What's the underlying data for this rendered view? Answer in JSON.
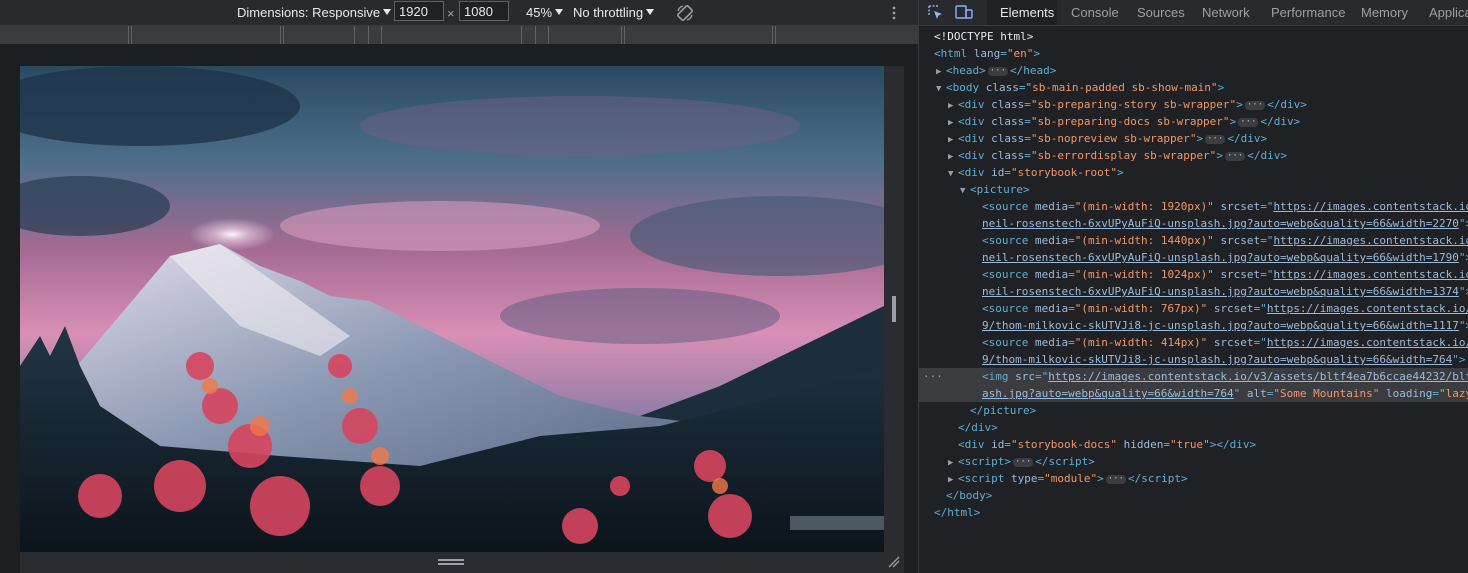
{
  "device_toolbar": {
    "dimensions_label": "Dimensions: Responsive",
    "width_value": "1920",
    "times": "×",
    "height_value": "1080",
    "zoom": "45%",
    "throttling": "No throttling",
    "rotate_icon": "rotate-icon",
    "more_icon": "more-vertical-icon"
  },
  "viewport": {
    "image_alt": "Some Mountains"
  },
  "devtools_tabs": [
    "Elements",
    "Console",
    "Sources",
    "Network",
    "Performance",
    "Memory",
    "Applica"
  ],
  "elements_tree": {
    "doctype": "<!DOCTYPE html>",
    "html_open": "html",
    "html_lang_attr": "lang",
    "html_lang_val": "\"en\"",
    "head": "head",
    "body_tag": "body",
    "body_class_val": "\"sb-main-padded sb-show-main\"",
    "div1_class": "\"sb-preparing-story sb-wrapper\"",
    "div2_class": "\"sb-preparing-docs sb-wrapper\"",
    "div3_class": "\"sb-nopreview sb-wrapper\"",
    "div4_class": "\"sb-errordisplay sb-wrapper\"",
    "root_id": "\"storybook-root\"",
    "picture": "picture",
    "sources": [
      {
        "media": "\"(min-width: 1920px)\"",
        "url1": "https://images.contentstack.io",
        "url2": "neil-rosenstech-6xvUPyAuFiQ-unsplash.jpg?auto=webp&quality=66&width=2270"
      },
      {
        "media": "\"(min-width: 1440px)\"",
        "url1": "https://images.contentstack.io",
        "url2": "neil-rosenstech-6xvUPyAuFiQ-unsplash.jpg?auto=webp&quality=66&width=1790"
      },
      {
        "media": "\"(min-width: 1024px)\"",
        "url1": "https://images.contentstack.io",
        "url2": "neil-rosenstech-6xvUPyAuFiQ-unsplash.jpg?auto=webp&quality=66&width=1374"
      },
      {
        "media": "\"(min-width: 767px)\"",
        "url1": "https://images.contentstack.io/",
        "url2": "9/thom-milkovic-skUTVJi8-jc-unsplash.jpg?auto=webp&quality=66&width=1117"
      },
      {
        "media": "\"(min-width: 414px)\"",
        "url1": "https://images.contentstack.io/",
        "url2": "9/thom-milkovic-skUTVJi8-jc-unsplash.jpg?auto=webp&quality=66&width=764"
      }
    ],
    "img_src1": "https://images.contentstack.io/v3/assets/bltf4ea7b6ccae44232/blt",
    "img_src2": "ash.jpg?auto=webp&quality=66&width=764",
    "img_alt": "\"Some Mountains\"",
    "img_loading": "\"lazy",
    "docs_id": "\"storybook-docs\"",
    "docs_hidden": "\"true\"",
    "script_type": "\"module\""
  }
}
